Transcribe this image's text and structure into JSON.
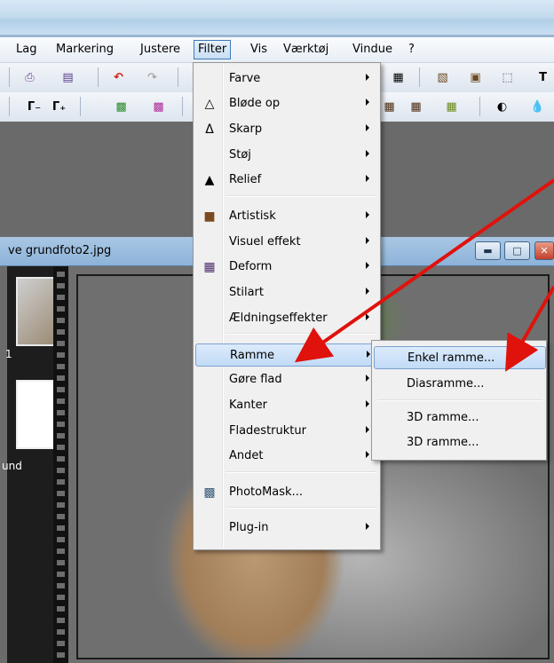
{
  "menubar": {
    "items": [
      {
        "label": "Lag"
      },
      {
        "label": "Markering"
      },
      {
        "label": "Justere"
      },
      {
        "label": "Filter"
      },
      {
        "label": "Vis"
      },
      {
        "label": "Værktøj"
      },
      {
        "label": "Vindue"
      },
      {
        "label": "?"
      }
    ]
  },
  "document": {
    "title": "ve grundfoto2.jpg",
    "thumb_labels": [
      "1",
      "und"
    ]
  },
  "filter_menu": {
    "items": [
      {
        "label": "Farve",
        "icon": "",
        "submenu": true
      },
      {
        "label": "Bløde op",
        "icon": "blur-icon",
        "submenu": true
      },
      {
        "label": "Skarp",
        "icon": "sharpen-icon",
        "submenu": true
      },
      {
        "label": "Støj",
        "icon": "",
        "submenu": true
      },
      {
        "label": "Relief",
        "icon": "relief-icon",
        "submenu": true
      },
      {
        "label": "Artistisk",
        "icon": "artistic-icon",
        "submenu": true
      },
      {
        "label": "Visuel effekt",
        "icon": "",
        "submenu": true
      },
      {
        "label": "Deform",
        "icon": "deform-icon",
        "submenu": true
      },
      {
        "label": "Stilart",
        "icon": "",
        "submenu": true
      },
      {
        "label": "Ældningseffekter",
        "icon": "",
        "submenu": true
      },
      {
        "label": "Ramme",
        "icon": "",
        "submenu": true,
        "highlighted": true
      },
      {
        "label": "Gøre flad",
        "icon": "",
        "submenu": true
      },
      {
        "label": "Kanter",
        "icon": "",
        "submenu": true
      },
      {
        "label": "Fladestruktur",
        "icon": "",
        "submenu": true
      },
      {
        "label": "Andet",
        "icon": "",
        "submenu": true
      },
      {
        "label": "PhotoMask...",
        "icon": "photomask-icon",
        "submenu": false
      },
      {
        "label": "Plug-in",
        "icon": "",
        "submenu": true
      }
    ]
  },
  "frame_submenu": {
    "items": [
      {
        "label": "Enkel ramme...",
        "highlighted": true
      },
      {
        "label": "Diasramme..."
      },
      {
        "label": "3D ramme..."
      },
      {
        "label": "3D ramme..."
      }
    ]
  },
  "colors": {
    "annotation_arrow": "#e0120c",
    "menu_highlight": "#c1dbf6"
  }
}
